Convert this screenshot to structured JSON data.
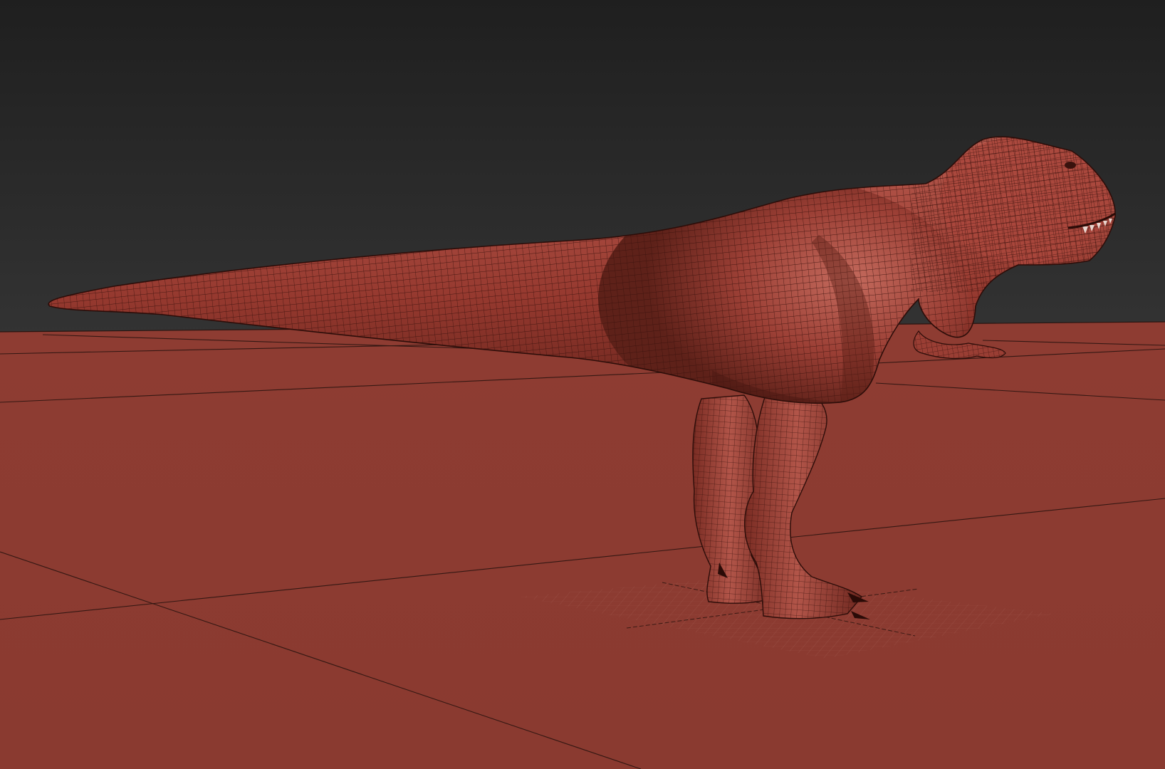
{
  "viewport": {
    "background_top_color": "#1f1f1f",
    "background_bottom_color": "#333333",
    "ground_color": "#8c3b31",
    "grid_line_color": "#2a1410",
    "local_grid_color": "#a86458"
  },
  "model": {
    "name": "t-rex",
    "display_mode": "wireframe-on-shaded",
    "surface_color": "#9b3f35",
    "surface_highlight_color": "#c46a5d",
    "surface_shadow_color": "#5e2119",
    "wire_color": "#3a120d"
  }
}
